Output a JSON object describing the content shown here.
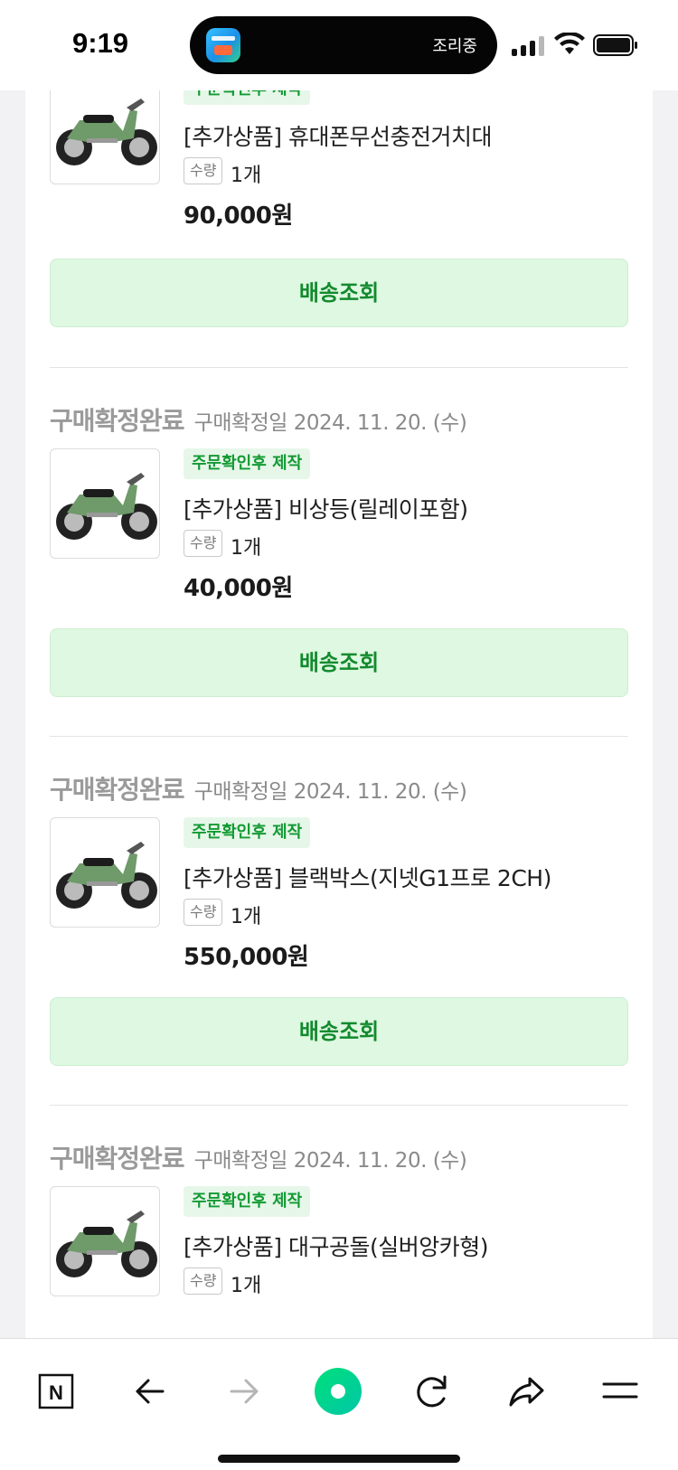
{
  "status_bar": {
    "time": "9:19",
    "island_activity": "조리중",
    "signal_bars_active": 3,
    "signal_bars_total": 4
  },
  "orders": [
    {
      "status": "",
      "date": "",
      "badge": "주문확인후 제작",
      "product_name": "[추가상품] 휴대폰무선충전거치대",
      "qty_label": "수량",
      "qty": "1개",
      "price": "90,000원",
      "button": "배송조회"
    },
    {
      "status": "구매확정완료",
      "date": "구매확정일 2024. 11. 20. (수)",
      "badge": "주문확인후 제작",
      "product_name": "[추가상품] 비상등(릴레이포함)",
      "qty_label": "수량",
      "qty": "1개",
      "price": "40,000원",
      "button": "배송조회"
    },
    {
      "status": "구매확정완료",
      "date": "구매확정일 2024. 11. 20. (수)",
      "badge": "주문확인후 제작",
      "product_name": "[추가상품] 블랙박스(지넷G1프로 2CH)",
      "qty_label": "수량",
      "qty": "1개",
      "price": "550,000원",
      "button": "배송조회"
    },
    {
      "status": "구매확정완료",
      "date": "구매확정일 2024. 11. 20. (수)",
      "badge": "주문확인후 제작",
      "product_name": "[추가상품] 대구공돌(실버앙카형)",
      "qty_label": "수량",
      "qty": "1개",
      "price": "",
      "button": ""
    }
  ],
  "toolbar": {
    "n_icon": "N",
    "items": [
      "naver-home-icon",
      "back-arrow-icon",
      "forward-arrow-icon",
      "green-dot-icon",
      "refresh-icon",
      "share-icon",
      "menu-icon"
    ]
  },
  "colors": {
    "badge_text": "#139a33",
    "badge_bg": "#e6f7e9",
    "button_bg": "#def8e1",
    "button_text": "#138a2e",
    "status_gray": "#9a9a9a",
    "toolbar_green": "#03c75a"
  }
}
